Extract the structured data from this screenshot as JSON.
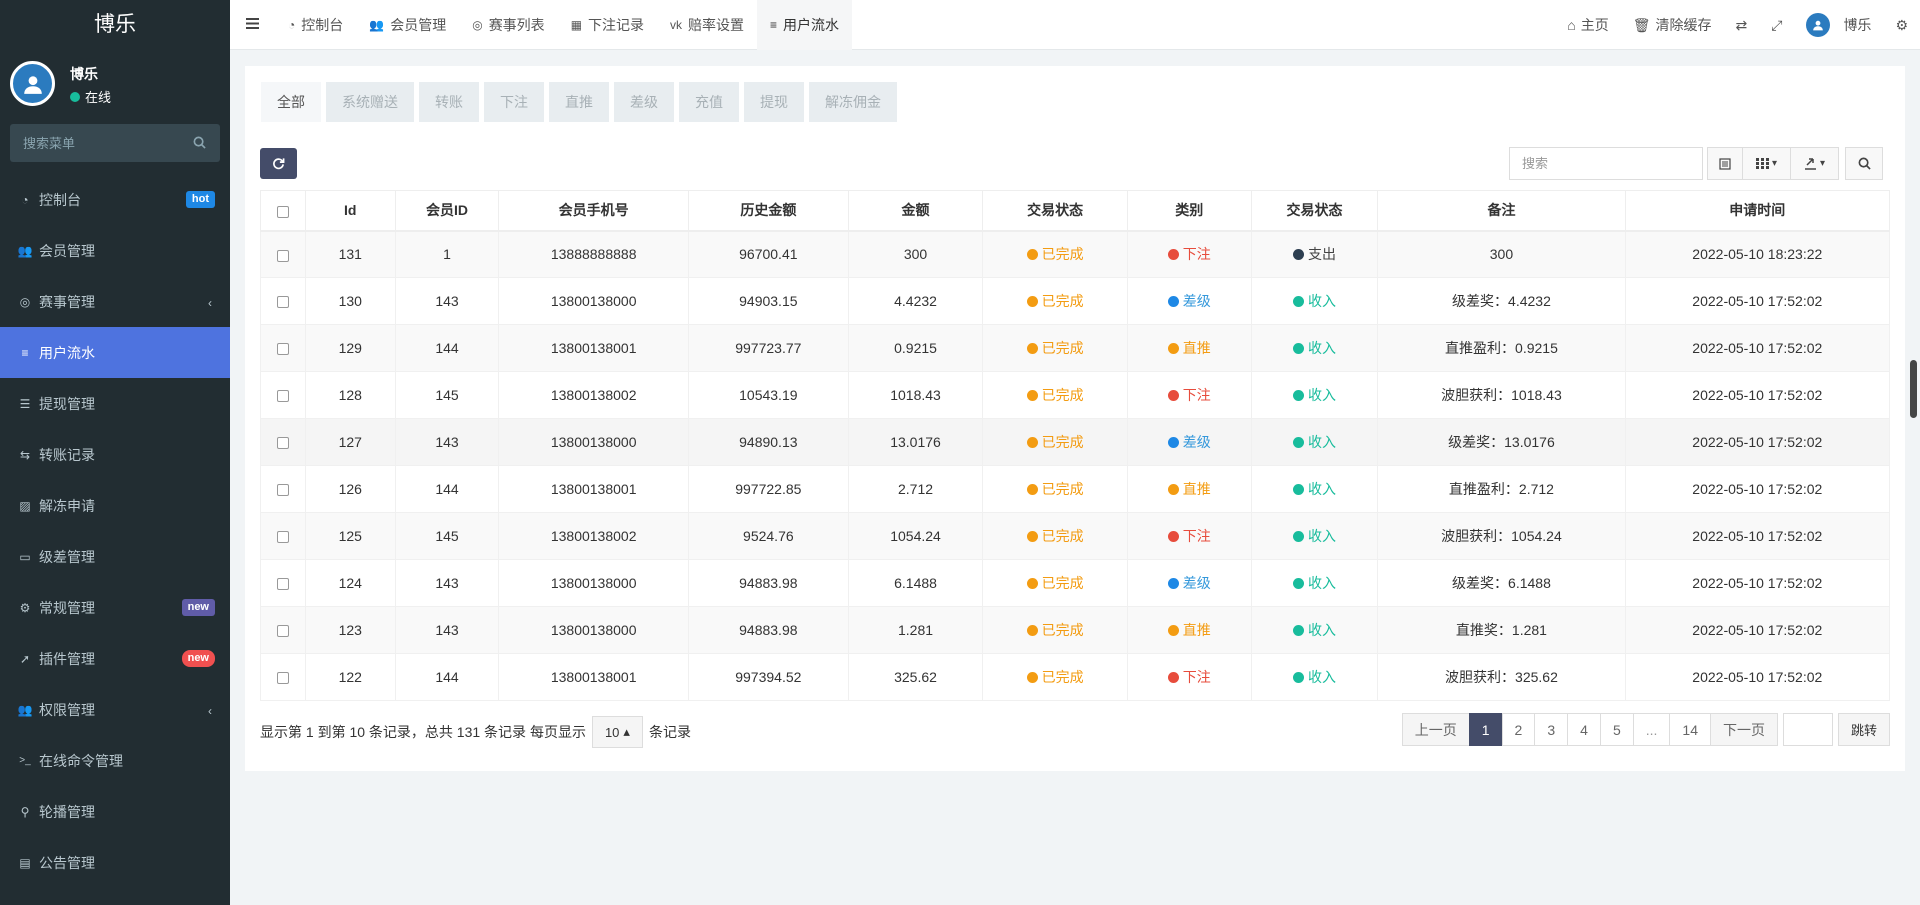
{
  "app": {
    "title": "博乐"
  },
  "user": {
    "name": "博乐",
    "status": "在线"
  },
  "sidebar": {
    "search_placeholder": "搜索菜单",
    "items": [
      {
        "label": "控制台",
        "icon": "dashboard-icon",
        "badge": "hot"
      },
      {
        "label": "会员管理",
        "icon": "users-icon"
      },
      {
        "label": "赛事管理",
        "icon": "globe-icon",
        "chevron": true
      },
      {
        "label": "用户流水",
        "icon": "list-icon",
        "active": true
      },
      {
        "label": "提现管理",
        "icon": "list-alt-icon"
      },
      {
        "label": "转账记录",
        "icon": "transfer-icon"
      },
      {
        "label": "解冻申请",
        "icon": "chart-icon"
      },
      {
        "label": "级差管理",
        "icon": "window-icon"
      },
      {
        "label": "常规管理",
        "icon": "cogs-icon",
        "badge": "new"
      },
      {
        "label": "插件管理",
        "icon": "rocket-icon",
        "badge": "new"
      },
      {
        "label": "权限管理",
        "icon": "group-icon",
        "chevron": true
      },
      {
        "label": "在线命令管理",
        "icon": "terminal-icon"
      },
      {
        "label": "轮播管理",
        "icon": "venus-icon"
      },
      {
        "label": "公告管理",
        "icon": "newspaper-icon"
      }
    ]
  },
  "topbar": {
    "tabs": [
      {
        "label": "控制台",
        "icon": "dashboard-icon"
      },
      {
        "label": "会员管理",
        "icon": "users-icon"
      },
      {
        "label": "赛事列表",
        "icon": "globe-icon"
      },
      {
        "label": "下注记录",
        "icon": "calendar-icon"
      },
      {
        "label": "赔率设置",
        "icon": "vk-icon"
      },
      {
        "label": "用户流水",
        "icon": "list-icon",
        "active": true
      }
    ],
    "home": "主页",
    "clear_cache": "清除缓存",
    "username": "博乐"
  },
  "subtabs": [
    "全部",
    "系统赠送",
    "转账",
    "下注",
    "直推",
    "差级",
    "充值",
    "提现",
    "解冻佣金"
  ],
  "toolbar": {
    "search_placeholder": "搜索"
  },
  "table": {
    "headers": [
      "Id",
      "会员ID",
      "会员手机号",
      "历史金额",
      "金额",
      "交易状态",
      "类别",
      "交易状态",
      "备注",
      "申请时间"
    ],
    "rows": [
      {
        "id": "131",
        "member_id": "1",
        "phone": "13888888888",
        "history": "96700.41",
        "amount": "300",
        "state": "已完成",
        "category": "下注",
        "category_color": "red",
        "flow": "支出",
        "flow_color": "navy",
        "note": "300",
        "time": "2022-05-10 18:23:22"
      },
      {
        "id": "130",
        "member_id": "143",
        "phone": "13800138000",
        "history": "94903.15",
        "amount": "4.4232",
        "state": "已完成",
        "category": "差级",
        "category_color": "blue",
        "flow": "收入",
        "flow_color": "green",
        "note": "级差奖：4.4232",
        "time": "2022-05-10 17:52:02"
      },
      {
        "id": "129",
        "member_id": "144",
        "phone": "13800138001",
        "history": "997723.77",
        "amount": "0.9215",
        "state": "已完成",
        "category": "直推",
        "category_color": "orange",
        "flow": "收入",
        "flow_color": "green",
        "note": "直推盈利：0.9215",
        "time": "2022-05-10 17:52:02"
      },
      {
        "id": "128",
        "member_id": "145",
        "phone": "13800138002",
        "history": "10543.19",
        "amount": "1018.43",
        "state": "已完成",
        "category": "下注",
        "category_color": "red",
        "flow": "收入",
        "flow_color": "green",
        "note": "波胆获利：1018.43",
        "time": "2022-05-10 17:52:02"
      },
      {
        "id": "127",
        "member_id": "143",
        "phone": "13800138000",
        "history": "94890.13",
        "amount": "13.0176",
        "state": "已完成",
        "category": "差级",
        "category_color": "blue",
        "flow": "收入",
        "flow_color": "green",
        "note": "级差奖：13.0176",
        "time": "2022-05-10 17:52:02"
      },
      {
        "id": "126",
        "member_id": "144",
        "phone": "13800138001",
        "history": "997722.85",
        "amount": "2.712",
        "state": "已完成",
        "category": "直推",
        "category_color": "orange",
        "flow": "收入",
        "flow_color": "green",
        "note": "直推盈利：2.712",
        "time": "2022-05-10 17:52:02"
      },
      {
        "id": "125",
        "member_id": "145",
        "phone": "13800138002",
        "history": "9524.76",
        "amount": "1054.24",
        "state": "已完成",
        "category": "下注",
        "category_color": "red",
        "flow": "收入",
        "flow_color": "green",
        "note": "波胆获利：1054.24",
        "time": "2022-05-10 17:52:02"
      },
      {
        "id": "124",
        "member_id": "143",
        "phone": "13800138000",
        "history": "94883.98",
        "amount": "6.1488",
        "state": "已完成",
        "category": "差级",
        "category_color": "blue",
        "flow": "收入",
        "flow_color": "green",
        "note": "级差奖：6.1488",
        "time": "2022-05-10 17:52:02"
      },
      {
        "id": "123",
        "member_id": "143",
        "phone": "13800138000",
        "history": "94883.98",
        "amount": "1.281",
        "state": "已完成",
        "category": "直推",
        "category_color": "orange",
        "flow": "收入",
        "flow_color": "green",
        "note": "直推奖：1.281",
        "time": "2022-05-10 17:52:02"
      },
      {
        "id": "122",
        "member_id": "144",
        "phone": "13800138001",
        "history": "997394.52",
        "amount": "325.62",
        "state": "已完成",
        "category": "下注",
        "category_color": "red",
        "flow": "收入",
        "flow_color": "green",
        "note": "波胆获利：325.62",
        "time": "2022-05-10 17:52:02"
      }
    ]
  },
  "pagination": {
    "info_prefix": "显示第 1 到第 10 条记录，总共 131 条记录 每页显示",
    "page_size": "10",
    "info_suffix": "条记录",
    "prev": "上一页",
    "pages": [
      "1",
      "2",
      "3",
      "4",
      "5",
      "...",
      "14"
    ],
    "current": "1",
    "next": "下一页",
    "jump": "跳转"
  }
}
